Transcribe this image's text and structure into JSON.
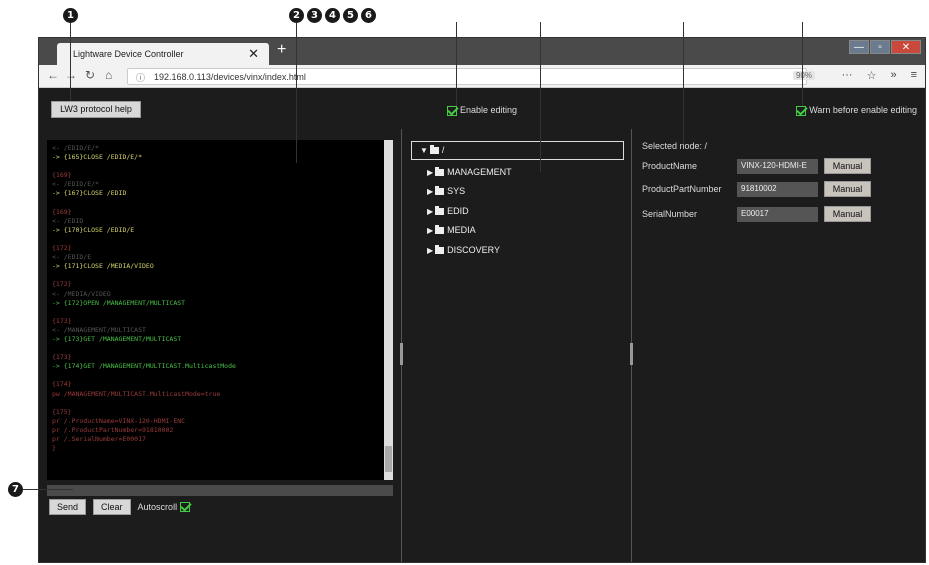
{
  "markers": [
    "1",
    "2",
    "3",
    "4",
    "5",
    "6",
    "7"
  ],
  "browser": {
    "tab_title": "Lightware Device Controller",
    "tab_close": "✕",
    "new_tab": "+",
    "url": "192.168.0.113/devices/vinx/index.html",
    "zoom": "90%",
    "window_controls": [
      "—",
      "▫",
      "✕"
    ],
    "toolbar_icons": [
      "···",
      "☆",
      "»",
      "≡"
    ]
  },
  "header": {
    "help_label": "LW3 protocol help",
    "enable_editing": "Enable editing",
    "warn_label": "Warn before enable editing"
  },
  "console": {
    "lines": [
      {
        "t": "<- /EDID/E/*",
        "c": "c-gray"
      },
      {
        "t": "-> {165}CLOSE /EDID/E/*",
        "c": "c-yellow"
      },
      {
        "t": "",
        "c": "c-gray"
      },
      {
        "t": "{169}",
        "c": "c-prompt"
      },
      {
        "t": "<- /EDID/E/*",
        "c": "c-gray"
      },
      {
        "t": "-> {167}CLOSE /EDID",
        "c": "c-yellow"
      },
      {
        "t": "",
        "c": "c-gray"
      },
      {
        "t": "{169}",
        "c": "c-prompt"
      },
      {
        "t": "<- /EDID",
        "c": "c-gray"
      },
      {
        "t": "-> {170}CLOSE /EDID/E",
        "c": "c-yellow"
      },
      {
        "t": "",
        "c": "c-gray"
      },
      {
        "t": "{172}",
        "c": "c-prompt"
      },
      {
        "t": "<- /EDID/E",
        "c": "c-gray"
      },
      {
        "t": "-> {171}CLOSE /MEDIA/VIDEO",
        "c": "c-yellow"
      },
      {
        "t": "",
        "c": "c-gray"
      },
      {
        "t": "{172}",
        "c": "c-prompt"
      },
      {
        "t": "<- /MEDIA/VIDEO",
        "c": "c-gray"
      },
      {
        "t": "-> {172}OPEN /MANAGEMENT/MULTICAST",
        "c": "c-green"
      },
      {
        "t": "",
        "c": "c-gray"
      },
      {
        "t": "{173}",
        "c": "c-prompt"
      },
      {
        "t": "<- /MANAGEMENT/MULTICAST",
        "c": "c-gray"
      },
      {
        "t": "-> {173}GET /MANAGEMENT/MULTICAST",
        "c": "c-green"
      },
      {
        "t": "",
        "c": "c-gray"
      },
      {
        "t": "{173}",
        "c": "c-prompt"
      },
      {
        "t": "-> {174}GET /MANAGEMENT/MULTICAST.MulticastMode",
        "c": "c-green"
      },
      {
        "t": "",
        "c": "c-gray"
      },
      {
        "t": "{174}",
        "c": "c-prompt"
      },
      {
        "t": "pw /MANAGEMENT/MULTICAST.MulticastMode=true",
        "c": "c-prompt"
      },
      {
        "t": "",
        "c": "c-gray"
      },
      {
        "t": "{175}",
        "c": "c-prompt"
      },
      {
        "t": "pr /.ProductName=VINX-120-HDMI-ENC",
        "c": "c-prompt"
      },
      {
        "t": "pr /.ProductPartNumber=91810002",
        "c": "c-prompt"
      },
      {
        "t": "pr /.SerialNumber=E00017",
        "c": "c-prompt"
      },
      {
        "t": "}",
        "c": "c-prompt"
      }
    ],
    "send_label": "Send",
    "clear_label": "Clear",
    "autoscroll_label": "Autoscroll"
  },
  "tree": {
    "root": "/",
    "items": [
      "MANAGEMENT",
      "SYS",
      "EDID",
      "MEDIA",
      "DISCOVERY"
    ]
  },
  "properties": {
    "selected_node": "Selected node: /",
    "rows": [
      {
        "label": "ProductName",
        "value": "VINX-120-HDMI-E",
        "button": "Manual"
      },
      {
        "label": "ProductPartNumber",
        "value": "91810002",
        "button": "Manual"
      },
      {
        "label": "SerialNumber",
        "value": "E00017",
        "button": "Manual"
      }
    ]
  }
}
